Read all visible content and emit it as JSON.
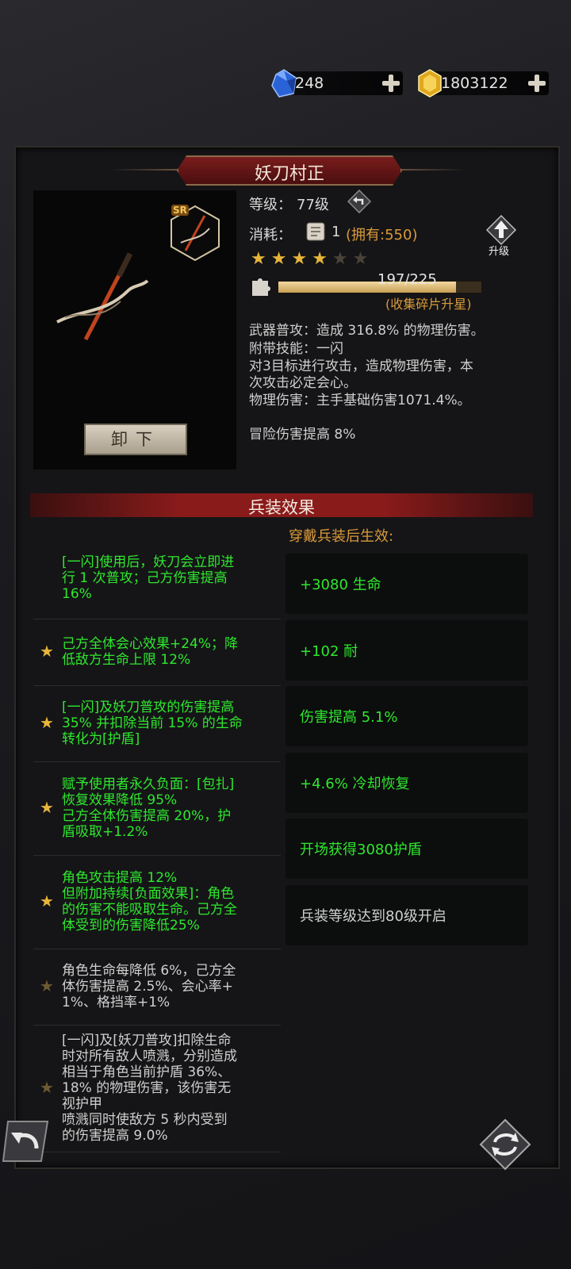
{
  "currency": {
    "gems": "248",
    "gold": "1803122"
  },
  "item": {
    "name": "妖刀村正",
    "rarity_badge": "SR",
    "level_label": "等级：",
    "level_value": "77级",
    "cost_label": "消耗：",
    "cost_value": "1",
    "owned": "(拥有:550)",
    "upgrade_label": "升级",
    "stars_filled": 4,
    "stars_total": 6,
    "fragments": "197/225",
    "fragments_progress": 0.876,
    "fragments_hint": "(收集碎片升星)",
    "desc_lines": [
      "武器普攻：造成 316.8% 的物理伤害。",
      "附带技能：一闪",
      "对3目标进行攻击，造成物理伤害，本",
      "次攻击必定会心。",
      "物理伤害：主手基础伤害1071.4%。"
    ],
    "extra_line": "冒险伤害提高 8%",
    "unequip_label": "卸下"
  },
  "effects_section": {
    "title": "兵装效果",
    "bonus_title": "穿戴兵装后生效:",
    "effects": [
      {
        "star": false,
        "active": true,
        "lines": [
          "[一闪]使用后，妖刀会立即进",
          "行 1 次普攻；己方伤害提高",
          "16%"
        ]
      },
      {
        "star": true,
        "active": true,
        "lines": [
          "己方全体会心效果+24%；降",
          "低敌方生命上限 12%"
        ]
      },
      {
        "star": true,
        "active": true,
        "lines": [
          "[一闪]及妖刀普攻的伤害提高",
          "35% 并扣除当前 15% 的生命",
          "转化为[护盾]"
        ]
      },
      {
        "star": true,
        "active": true,
        "lines": [
          "赋予使用者永久负面：[包扎]",
          "恢复效果降低 95%",
          "己方全体伤害提高 20%，护",
          "盾吸取+1.2%"
        ]
      },
      {
        "star": true,
        "active": true,
        "lines": [
          "角色攻击提高 12%",
          "但附加持续[负面效果]：角色",
          "的伤害不能吸取生命。己方全",
          "体受到的伤害降低25%"
        ]
      },
      {
        "star": true,
        "active": false,
        "lines": [
          "角色生命每降低 6%，己方全",
          "体伤害提高 2.5%、会心率+",
          "1%、格挡率+1%"
        ]
      },
      {
        "star": true,
        "active": false,
        "lines": [
          "[一闪]及[妖刀普攻]扣除生命",
          "时对所有敌人喷溅，分别造成",
          "相当于角色当前护盾 36%、",
          "18% 的物理伤害，该伤害无",
          "视护甲",
          "喷溅同时使敌方 5 秒内受到",
          "的伤害提高 9.0%"
        ]
      }
    ],
    "bonuses": [
      {
        "text": "+3080 生命",
        "active": true
      },
      {
        "text": "+102 耐",
        "active": true
      },
      {
        "text": "伤害提高 5.1%",
        "active": true
      },
      {
        "text": "+4.6% 冷却恢复",
        "active": true
      },
      {
        "text": "开场获得3080护盾",
        "active": true
      },
      {
        "text": "兵装等级达到80级开启",
        "active": false
      }
    ]
  },
  "colors": {
    "active_green": "#2ee82e",
    "inactive_text": "#cfcfcf",
    "gold_text": "#d99a3a",
    "star_gold": "#e8b53a",
    "star_dim": "#4a4438"
  }
}
